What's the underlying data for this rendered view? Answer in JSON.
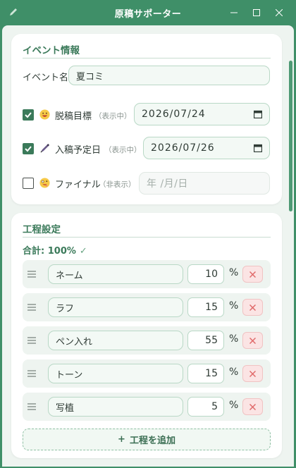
{
  "window": {
    "title": "原稿サポーター",
    "minimize_icon": "minimize-icon",
    "maximize_icon": "maximize-icon",
    "close_icon": "close-icon",
    "app_icon": "pencil-icon"
  },
  "colors": {
    "accent": "#3b7a5a",
    "titlebar": "#3f8f68",
    "delete": "#e06a6a"
  },
  "event": {
    "section_title": "イベント情報",
    "name_label": "イベント名",
    "name_value": "夏コミ",
    "deadlines": [
      {
        "icon": "grinning-face-icon",
        "label": "脱稿目標",
        "status": "（表示中）",
        "checked": true,
        "value": "2026/07/24",
        "placeholder": ""
      },
      {
        "icon": "fountain-pen-icon",
        "label": "入稿予定日",
        "status": "（表示中）",
        "checked": true,
        "value": "2026/07/26",
        "placeholder": ""
      },
      {
        "icon": "zany-face-icon",
        "label": "ファイナル",
        "status": "（非表示）",
        "checked": false,
        "value": "",
        "placeholder": "年 /月/日"
      }
    ]
  },
  "process": {
    "section_title": "工程設定",
    "total_label": "合計: 100%",
    "total_check": "✓",
    "percent_sign": "%",
    "delete_symbol": "×",
    "steps": [
      {
        "name": "ネーム",
        "percent": "10"
      },
      {
        "name": "ラフ",
        "percent": "15"
      },
      {
        "name": "ペン入れ",
        "percent": "55"
      },
      {
        "name": "トーン",
        "percent": "15"
      },
      {
        "name": "写植",
        "percent": "5"
      }
    ],
    "add_plus": "+",
    "add_label": "工程を追加"
  }
}
